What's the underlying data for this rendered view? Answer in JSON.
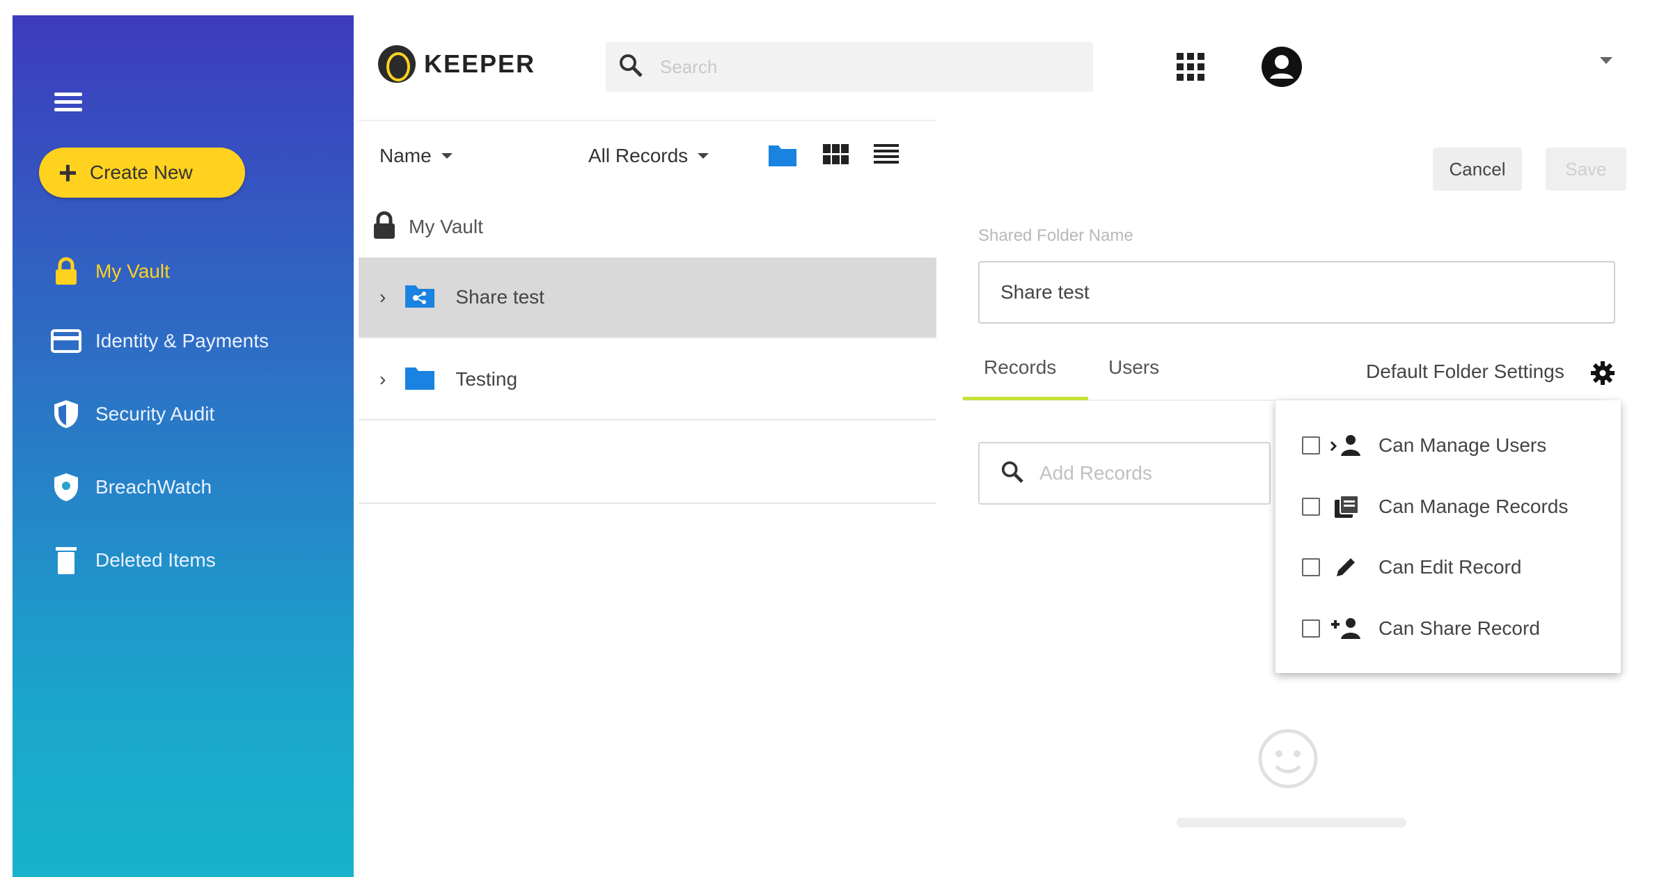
{
  "app": {
    "name": "KEEPER"
  },
  "header": {
    "search_placeholder": "Search"
  },
  "sidebar": {
    "create_new": "Create New",
    "items": [
      {
        "label": "My Vault",
        "icon": "lock-icon",
        "active": true
      },
      {
        "label": "Identity & Payments",
        "icon": "credit-card-icon"
      },
      {
        "label": "Security Audit",
        "icon": "shield-icon"
      },
      {
        "label": "BreachWatch",
        "icon": "breachwatch-shield-icon"
      },
      {
        "label": "Deleted Items",
        "icon": "trash-icon"
      }
    ]
  },
  "toolbar": {
    "sort_name": "Name",
    "filter": "All Records"
  },
  "vault": {
    "title": "My Vault",
    "rows": [
      {
        "label": "Share test",
        "type": "shared-folder",
        "selected": true
      },
      {
        "label": "Testing",
        "type": "folder"
      }
    ]
  },
  "panel": {
    "cancel": "Cancel",
    "save": "Save",
    "folder_name_label": "Shared Folder Name",
    "folder_name_value": "Share test",
    "tabs": [
      "Records",
      "Users"
    ],
    "default_settings": "Default Folder Settings",
    "add_records_placeholder": "Add Records"
  },
  "menu": {
    "items": [
      {
        "label": "Can Manage Users",
        "icon": "manage-users-icon",
        "checked": false
      },
      {
        "label": "Can Manage Records",
        "icon": "manage-records-icon",
        "checked": false
      },
      {
        "label": "Can Edit Record",
        "icon": "edit-pencil-icon",
        "checked": false
      },
      {
        "label": "Can Share Record",
        "icon": "share-user-icon",
        "checked": false
      }
    ]
  },
  "colors": {
    "accent": "#ffd21f",
    "folder_blue": "#1a82e0",
    "tab_active": "#c7e23a",
    "sidebar_top": "#3d3bbd",
    "sidebar_bottom": "#18b2cc"
  }
}
